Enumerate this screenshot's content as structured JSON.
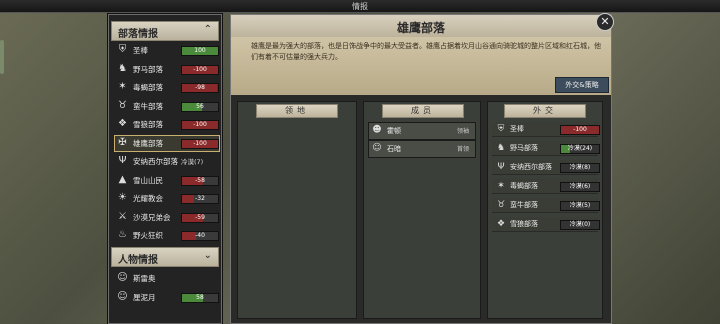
{
  "window_title": "情报",
  "tribes_panel": {
    "title": "部落情报",
    "items": [
      {
        "name": "圣棒",
        "value": "100",
        "color": "#4a8a3a",
        "icon": "shield-icon",
        "prefix": "★"
      },
      {
        "name": "野马部落",
        "value": "-100",
        "color": "#8a2a2a",
        "icon": "horse-icon"
      },
      {
        "name": "毒蝎部落",
        "value": "-98",
        "color": "#8a2a2a",
        "icon": "scorpion-icon"
      },
      {
        "name": "蛮牛部落",
        "value": "56",
        "color": "#4a8a3a",
        "icon": "bull-icon"
      },
      {
        "name": "雪狼部落",
        "value": "-100",
        "color": "#8a2a2a",
        "icon": "wolf-icon"
      },
      {
        "name": "雄鹰部落",
        "value": "-100",
        "color": "#8a2a2a",
        "icon": "eagle-icon"
      },
      {
        "name": "安纳西尔部落",
        "value": "",
        "label": "冷漠(7)",
        "icon": "antler-icon"
      },
      {
        "name": "雪山山民",
        "value": "-58",
        "color": "#8a2a2a",
        "icon": "mountain-icon"
      },
      {
        "name": "光耀教会",
        "value": "-32",
        "color": "#8a2a2a",
        "icon": "sun-icon"
      },
      {
        "name": "沙漠兄弟会",
        "value": "-59",
        "color": "#8a2a2a",
        "icon": "swords-icon"
      },
      {
        "name": "野火狂织",
        "value": "-40",
        "color": "#8a2a2a",
        "icon": "fire-icon"
      }
    ]
  },
  "people_panel": {
    "title": "人物情报",
    "items": [
      {
        "name": "斯雷奥",
        "value": "",
        "icon": "person-icon"
      },
      {
        "name": "厘泥月",
        "value": "58",
        "color": "#4a8a3a",
        "icon": "person-icon"
      }
    ]
  },
  "detail": {
    "title": "雄鹰部落",
    "description": "雄鹰是最为强大的部落，也是日饰战争中的最大受益者。雄鹰占据着坎月山谷通向骑驼城的整片区域和红石城，他们有着不可估量的强大兵力。",
    "diplomacy_button": "外交&策略",
    "territory_header": "领地",
    "members_header": "成员",
    "members": [
      {
        "name": "霍顿",
        "tag": "领袖",
        "icon": "chief-portrait-icon"
      },
      {
        "name": "石暗",
        "tag": "首领",
        "icon": "warrior-portrait-icon"
      }
    ],
    "relations_header": "外交",
    "relations": [
      {
        "name": "圣棒",
        "value": "-100",
        "color": "#8a2a2a",
        "icon": "shield-icon"
      },
      {
        "name": "野马部落",
        "value": "",
        "label": "冷漠(24)",
        "color": "#4a8a3a",
        "icon": "horse-icon"
      },
      {
        "name": "安纳西尔部落",
        "value": "",
        "label": "冷漠(8)",
        "icon": "antler-icon"
      },
      {
        "name": "毒蝎部落",
        "value": "",
        "label": "冷漠(6)",
        "icon": "scorpion-icon"
      },
      {
        "name": "蛮牛部落",
        "value": "",
        "label": "冷漠(5)",
        "icon": "bull-icon"
      },
      {
        "name": "雪狼部落",
        "value": "",
        "label": "冷漠(0)",
        "icon": "wolf-icon"
      }
    ]
  }
}
